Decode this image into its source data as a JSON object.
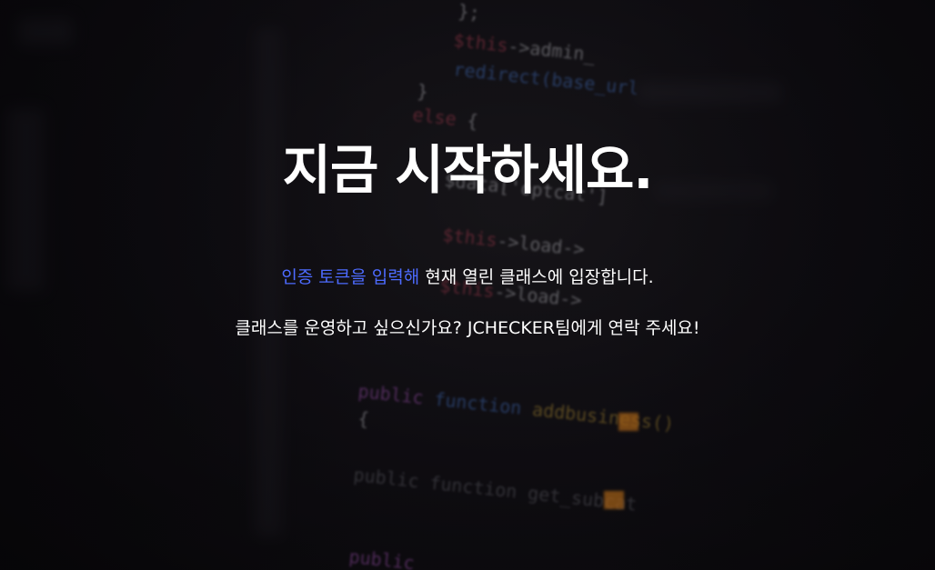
{
  "hero": {
    "headline": "지금 시작하세요.",
    "token_link": "인증 토큰을 입력해",
    "line1_rest": " 현재 열린 클래스에 입장합니다.",
    "line2": "클래스를 운영하고 싶으신가요? JCHECKER팀에게 연락 주세요!",
    "colors": {
      "link": "#4d6bff",
      "text": "#ffffff",
      "background": "#0b0a0d"
    }
  }
}
